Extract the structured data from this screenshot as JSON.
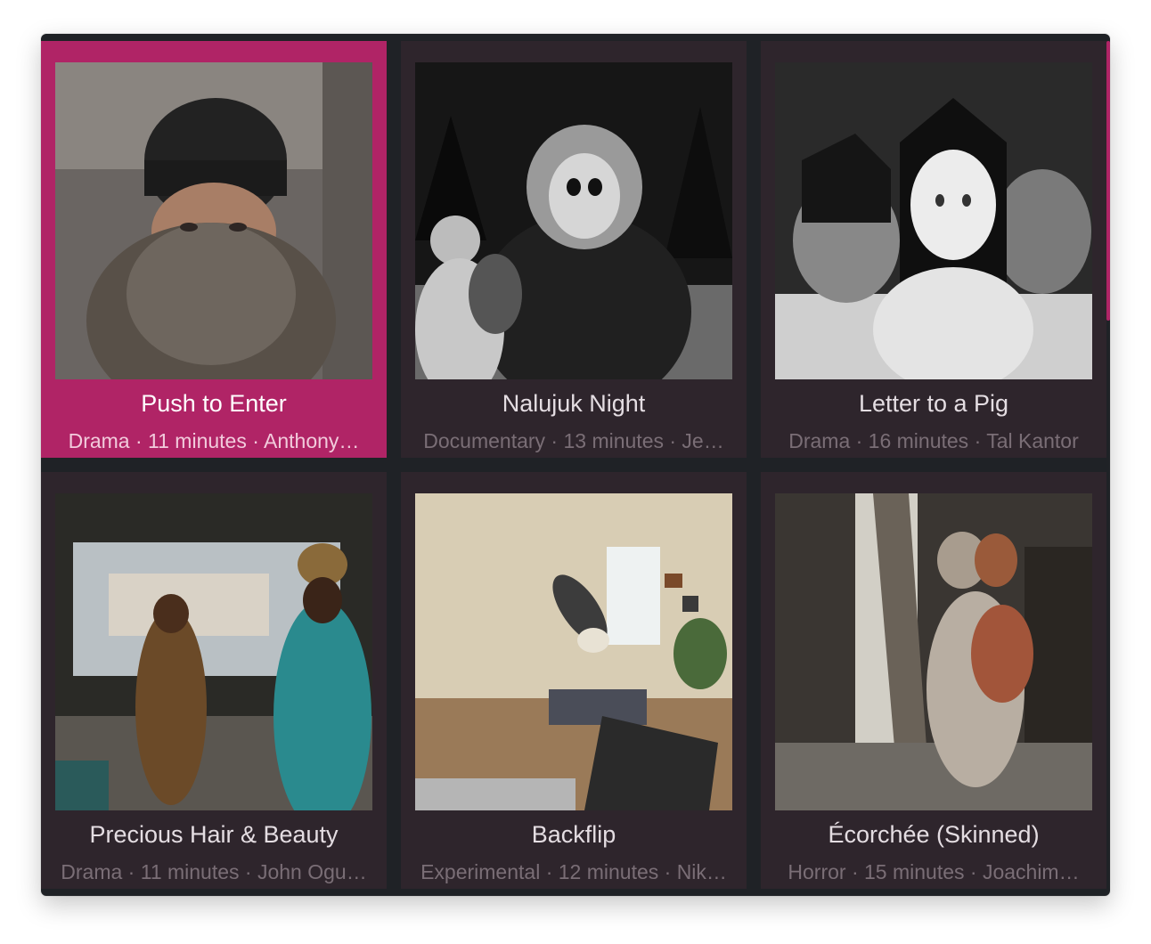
{
  "films": [
    {
      "title": "Push to Enter",
      "meta": "Drama · 11 minutes · Anthony…",
      "selected": true
    },
    {
      "title": "Nalujuk Night",
      "meta": "Documentary · 13 minutes · Je…",
      "selected": false
    },
    {
      "title": "Letter to a Pig",
      "meta": "Drama · 16 minutes · Tal Kantor",
      "selected": false
    },
    {
      "title": "Precious Hair & Beauty",
      "meta": "Drama · 11 minutes · John Ogu…",
      "selected": false
    },
    {
      "title": "Backflip",
      "meta": "Experimental · 12 minutes · Nik…",
      "selected": false
    },
    {
      "title": "Écorchée (Skinned)",
      "meta": "Horror · 15 minutes · Joachim…",
      "selected": false
    }
  ],
  "colors": {
    "accent": "#b02466",
    "tile_background": "#2e252c",
    "window_background": "#1f2226"
  }
}
